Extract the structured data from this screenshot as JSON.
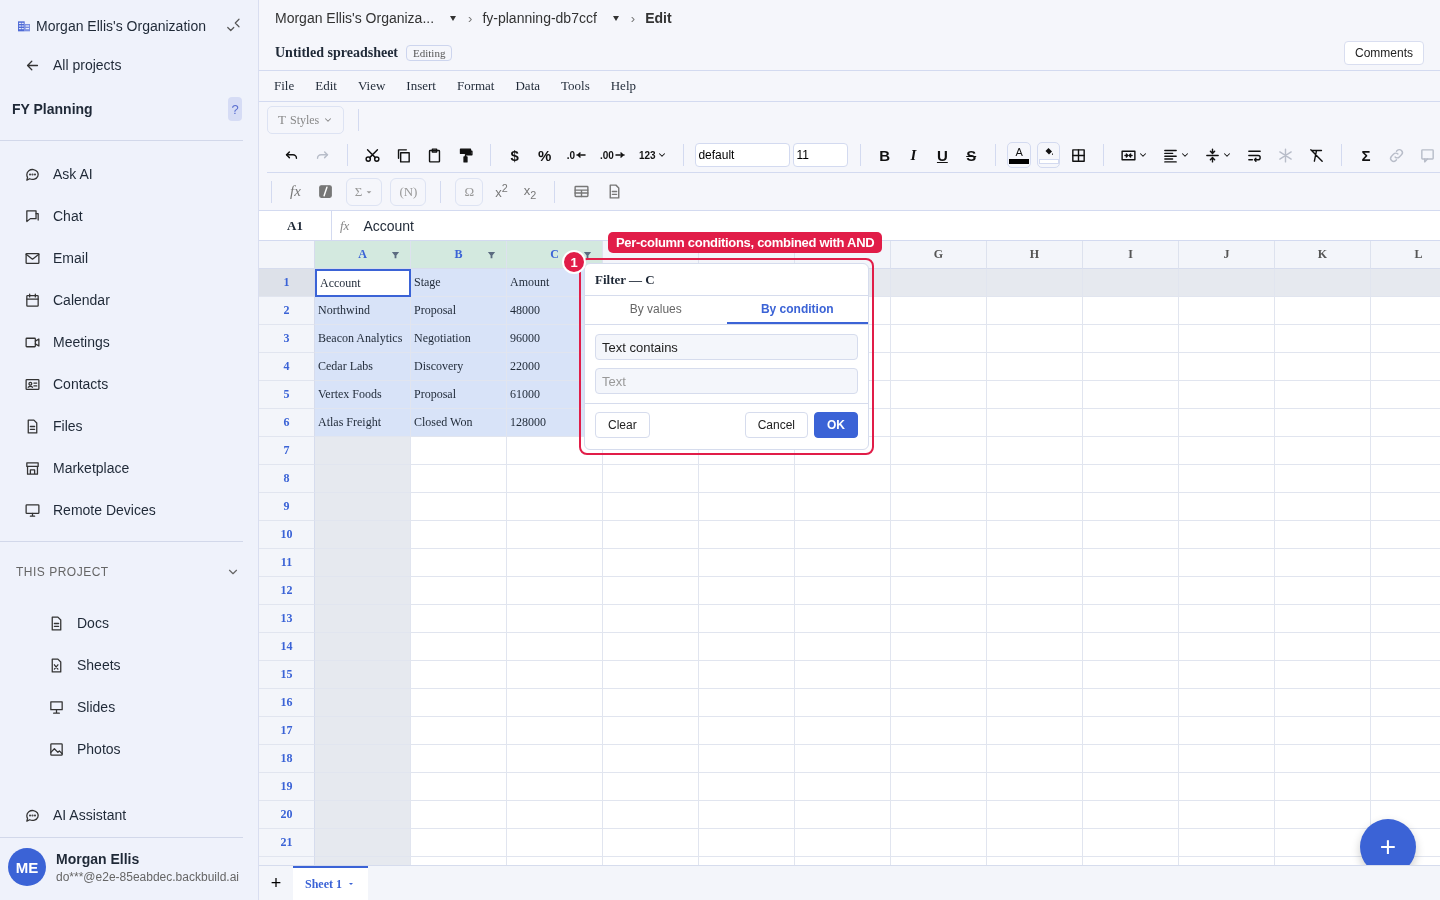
{
  "sidebar": {
    "org": "Morgan Ellis's Organization",
    "back": "All projects",
    "project": "FY Planning",
    "help": "?",
    "nav": [
      {
        "kind": "chat",
        "label": "Ask AI"
      },
      {
        "kind": "message",
        "label": "Chat"
      },
      {
        "kind": "mail",
        "label": "Email"
      },
      {
        "kind": "calendar",
        "label": "Calendar"
      },
      {
        "kind": "video",
        "label": "Meetings"
      },
      {
        "kind": "contact",
        "label": "Contacts"
      },
      {
        "kind": "file",
        "label": "Files"
      },
      {
        "kind": "store",
        "label": "Marketplace"
      },
      {
        "kind": "monitor",
        "label": "Remote Devices"
      }
    ],
    "section": {
      "label": "THIS PROJECT",
      "expanded": true
    },
    "project_items": [
      {
        "kind": "doc",
        "label": "Docs"
      },
      {
        "kind": "sheet",
        "label": "Sheets"
      },
      {
        "kind": "slides",
        "label": "Slides"
      },
      {
        "kind": "photo",
        "label": "Photos"
      }
    ],
    "assistant": {
      "kind": "chat",
      "label": "AI Assistant"
    },
    "user": {
      "initials": "ME",
      "name": "Morgan Ellis",
      "email": "do***@e2e-85eabdec.backbuild.ai"
    }
  },
  "breadcrumb": [
    {
      "label": "Morgan Ellis's Organiza...",
      "dropdown": true
    },
    {
      "separator": "›",
      "label": "fy-planning-db7ccf",
      "dropdown": true
    },
    {
      "separator": "›",
      "label": "Edit",
      "dropdown": false
    }
  ],
  "document": {
    "title": "Untitled spreadsheet",
    "status": "Editing",
    "comments_button": "Comments"
  },
  "menu": [
    "File",
    "Edit",
    "View",
    "Insert",
    "Format",
    "Data",
    "Tools",
    "Help"
  ],
  "styles_button": {
    "glyph": "T",
    "label": "Styles"
  },
  "toolbar": [
    {
      "kind": "undo",
      "disabled": false
    },
    {
      "kind": "redo",
      "disabled": true
    },
    {
      "kind": "sep"
    },
    {
      "kind": "cut",
      "disabled": false
    },
    {
      "kind": "copy",
      "disabled": false
    },
    {
      "kind": "paste",
      "disabled": false
    },
    {
      "kind": "paint",
      "disabled": false
    },
    {
      "kind": "sep"
    },
    {
      "kind": "glyph",
      "label": "$"
    },
    {
      "kind": "glyph",
      "label": "%"
    },
    {
      "kind": "decimal",
      "label": ".0"
    },
    {
      "kind": "decimal",
      "label": ".00"
    },
    {
      "kind": "select",
      "label": "123"
    },
    {
      "kind": "sep"
    },
    {
      "kind": "field",
      "value": "default"
    },
    {
      "kind": "size",
      "value": "11"
    },
    {
      "kind": "sep"
    },
    {
      "kind": "bold",
      "label": "B"
    },
    {
      "kind": "italic",
      "label": "I"
    },
    {
      "kind": "underline",
      "label": "U"
    },
    {
      "kind": "strike",
      "label": "S"
    },
    {
      "kind": "sep"
    },
    {
      "kind": "color",
      "label": "A",
      "color": "#000000"
    },
    {
      "kind": "fill",
      "color": "#ffffff"
    },
    {
      "kind": "borders",
      "disabled": false
    },
    {
      "kind": "sep"
    },
    {
      "kind": "merge",
      "disabled": false
    },
    {
      "kind": "align",
      "disabled": false
    },
    {
      "kind": "valign",
      "disabled": false
    },
    {
      "kind": "wrap",
      "disabled": false
    },
    {
      "kind": "freeze",
      "disabled": true
    },
    {
      "kind": "clear",
      "disabled": false
    },
    {
      "kind": "sep"
    },
    {
      "kind": "glyph",
      "label": "Σ"
    },
    {
      "kind": "link",
      "disabled": true
    },
    {
      "kind": "comment",
      "disabled": true
    }
  ],
  "toolbar2": [
    {
      "kind": "italicglyph",
      "label": "fx"
    },
    {
      "kind": "formula"
    },
    {
      "kind": "boxed",
      "label": "Σ",
      "caret": true
    },
    {
      "kind": "boxed",
      "label": "(N)",
      "caret": false
    },
    {
      "kind": "sep"
    },
    {
      "kind": "boxed",
      "label": "Ω",
      "caret": false
    },
    {
      "kind": "rich",
      "label": "x$^{2}$"
    },
    {
      "kind": "rich",
      "label": "x$_{2}$"
    },
    {
      "kind": "sep"
    },
    {
      "kind": "table"
    },
    {
      "kind": "doc"
    }
  ],
  "formula_bar": {
    "cell": "A1",
    "fx": "fx",
    "value": "Account"
  },
  "grid": {
    "columns": [
      {
        "label": "A",
        "filter": true,
        "selected": true
      },
      {
        "label": "B",
        "filter": true,
        "selected": true
      },
      {
        "label": "C",
        "filter": true,
        "selected": true
      },
      {
        "filter": false,
        "selected": false
      },
      {
        "filter": false,
        "selected": false
      },
      {
        "filter": false,
        "selected": false
      },
      {
        "label": "G",
        "filter": false,
        "selected": false
      },
      {
        "label": "H",
        "filter": false,
        "selected": false
      },
      {
        "label": "I",
        "filter": false,
        "selected": false
      },
      {
        "label": "J",
        "filter": false,
        "selected": false
      },
      {
        "label": "K",
        "filter": false,
        "selected": false
      },
      {
        "label": "L",
        "filter": false,
        "selected": false
      }
    ],
    "rows": [
      {
        "number": "1",
        "active": true,
        "selected": true,
        "cells": [
          "Account",
          "Stage",
          "Amount"
        ]
      },
      {
        "number": "2",
        "active": false,
        "selected": true,
        "cells": [
          "Northwind",
          "Proposal",
          "48000"
        ]
      },
      {
        "number": "3",
        "active": false,
        "selected": true,
        "cells": [
          "Beacon Analytics",
          "Negotiation",
          "96000"
        ]
      },
      {
        "number": "4",
        "active": false,
        "selected": true,
        "cells": [
          "Cedar Labs",
          "Discovery",
          "22000"
        ]
      },
      {
        "number": "5",
        "active": false,
        "selected": true,
        "cells": [
          "Vertex Foods",
          "Proposal",
          "61000"
        ]
      },
      {
        "number": "6",
        "active": false,
        "selected": true,
        "cells": [
          "Atlas Freight",
          "Closed Won",
          "128000"
        ]
      },
      {
        "number": "7",
        "active": false,
        "selected": false
      },
      {
        "number": "8",
        "active": false,
        "selected": false
      },
      {
        "number": "9",
        "active": false,
        "selected": false
      },
      {
        "number": "10",
        "active": false,
        "selected": false
      },
      {
        "number": "11",
        "active": false,
        "selected": false
      },
      {
        "number": "12",
        "active": false,
        "selected": false
      },
      {
        "number": "13",
        "active": false,
        "selected": false
      },
      {
        "number": "14",
        "active": false,
        "selected": false
      },
      {
        "number": "15",
        "active": false,
        "selected": false
      },
      {
        "number": "16",
        "active": false,
        "selected": false
      },
      {
        "number": "17",
        "active": false,
        "selected": false
      },
      {
        "number": "18",
        "active": false,
        "selected": false
      },
      {
        "number": "19",
        "active": false,
        "selected": false
      },
      {
        "number": "20",
        "active": false,
        "selected": false
      },
      {
        "number": "21",
        "active": false,
        "selected": false
      }
    ]
  },
  "callout": {
    "badge": "1",
    "text": "Per-column conditions, combined with AND"
  },
  "filter_popup": {
    "title": "Filter — C",
    "tabs": [
      {
        "label": "By values",
        "selected": false
      },
      {
        "label": "By condition",
        "selected": true
      }
    ],
    "condition": "Text contains",
    "value_placeholder": "Text",
    "buttons": {
      "clear": "Clear",
      "cancel": "Cancel",
      "ok": "OK"
    }
  },
  "sheet_tabs": {
    "add": "+",
    "tabs": [
      {
        "label": "Sheet 1",
        "selected": true
      }
    ]
  },
  "fab": {
    "label": "+"
  }
}
